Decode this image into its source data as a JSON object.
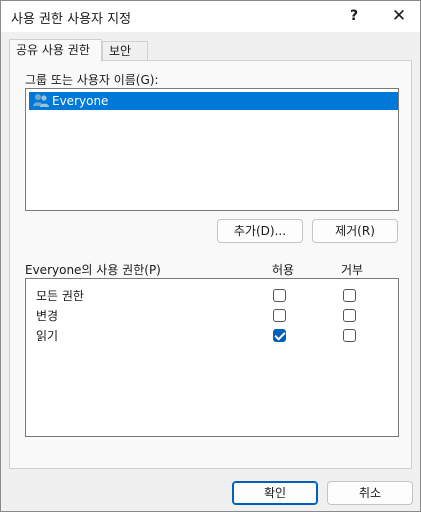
{
  "window": {
    "title": "사용 권한 사용자 지정",
    "help_glyph": "?",
    "close_glyph": "✕"
  },
  "tabs": [
    {
      "label": "공유 사용 권한",
      "active": true
    },
    {
      "label": "보안",
      "active": false
    }
  ],
  "groups": {
    "label": "그룹 또는 사용자 이름(G):",
    "items": [
      {
        "label": "Everyone",
        "icon": "users-icon",
        "selected": true
      }
    ]
  },
  "group_buttons": {
    "add_label": "추가(D)...",
    "remove_label": "제거(R)"
  },
  "permissions": {
    "label": "Everyone의 사용 권한(P)",
    "allow_header": "허용",
    "deny_header": "거부",
    "rows": [
      {
        "name": "모든 권한",
        "allow": false,
        "deny": false
      },
      {
        "name": "변경",
        "allow": false,
        "deny": false
      },
      {
        "name": "읽기",
        "allow": true,
        "deny": false
      }
    ]
  },
  "footer": {
    "ok_label": "확인",
    "cancel_label": "취소"
  },
  "colors": {
    "selection": "#0078d7",
    "accent": "#005fb8"
  }
}
